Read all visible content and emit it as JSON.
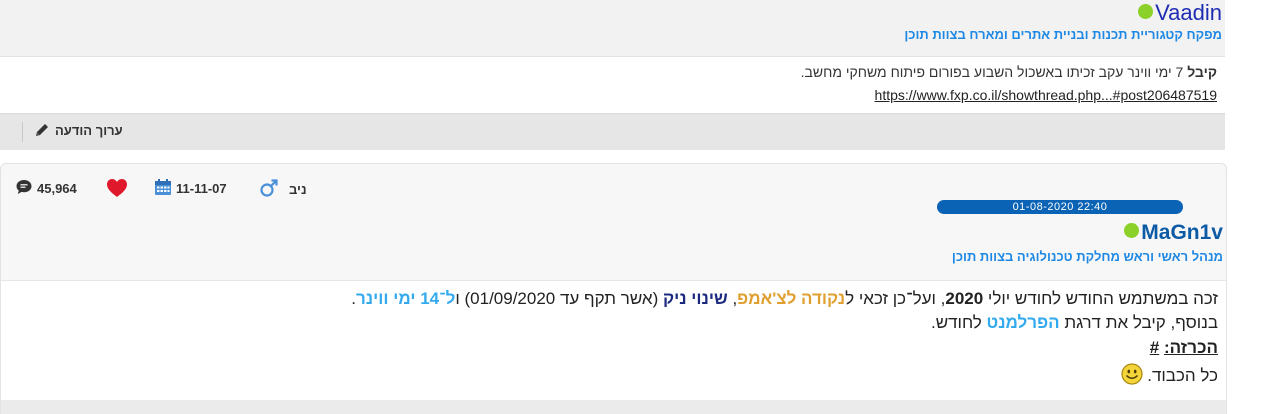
{
  "prev_post": {
    "username": "Vaadin",
    "user_title": "מפקח קטגוריית תכנות ובניית אתרים ומארח בצוות תוכן",
    "body_bold": "קיבל",
    "body_text": " 7 ימי ווינר עקב זכיתו באשכול השבוע בפורום פיתוח משחקי מחשב.",
    "link": "https://www.fxp.co.il/showthread.php...#post206487519",
    "edit_label": "ערוך הודעה"
  },
  "post": {
    "meta": {
      "gender_label": "ניב",
      "join_date": "11-11-07",
      "post_count": "45,964"
    },
    "timestamp": "01-08-2020 22:40",
    "username": "MaGn1v",
    "user_title": "מנהל ראשי וראש מחלקת טכנולוגיה בצוות תוכן",
    "line1": {
      "a": "זכה במשתמש החודש לחודש יולי ",
      "b": "2020",
      "c": ", ועל־כן זכאי ל",
      "d": "נקודה לצ'אמפ",
      "e": ", ",
      "f": "שינוי ניק",
      "g": " (אשר תקף עד 01/09/2020) ו",
      "h": "ל־14 ימי ווינר",
      "i": "."
    },
    "line2": {
      "a": "בנוסף, קיבל את דרגת ",
      "b": "הפרלמנט",
      "c": " לחודש."
    },
    "announcement_label": "הכרזה:",
    "announcement_link": "#",
    "closing": "כל הכבוד."
  },
  "colors": {
    "online": "#8bd12a",
    "accent_blue": "#1e88e5",
    "date_bar": "#0b63b5",
    "heart": "#e0182b"
  }
}
